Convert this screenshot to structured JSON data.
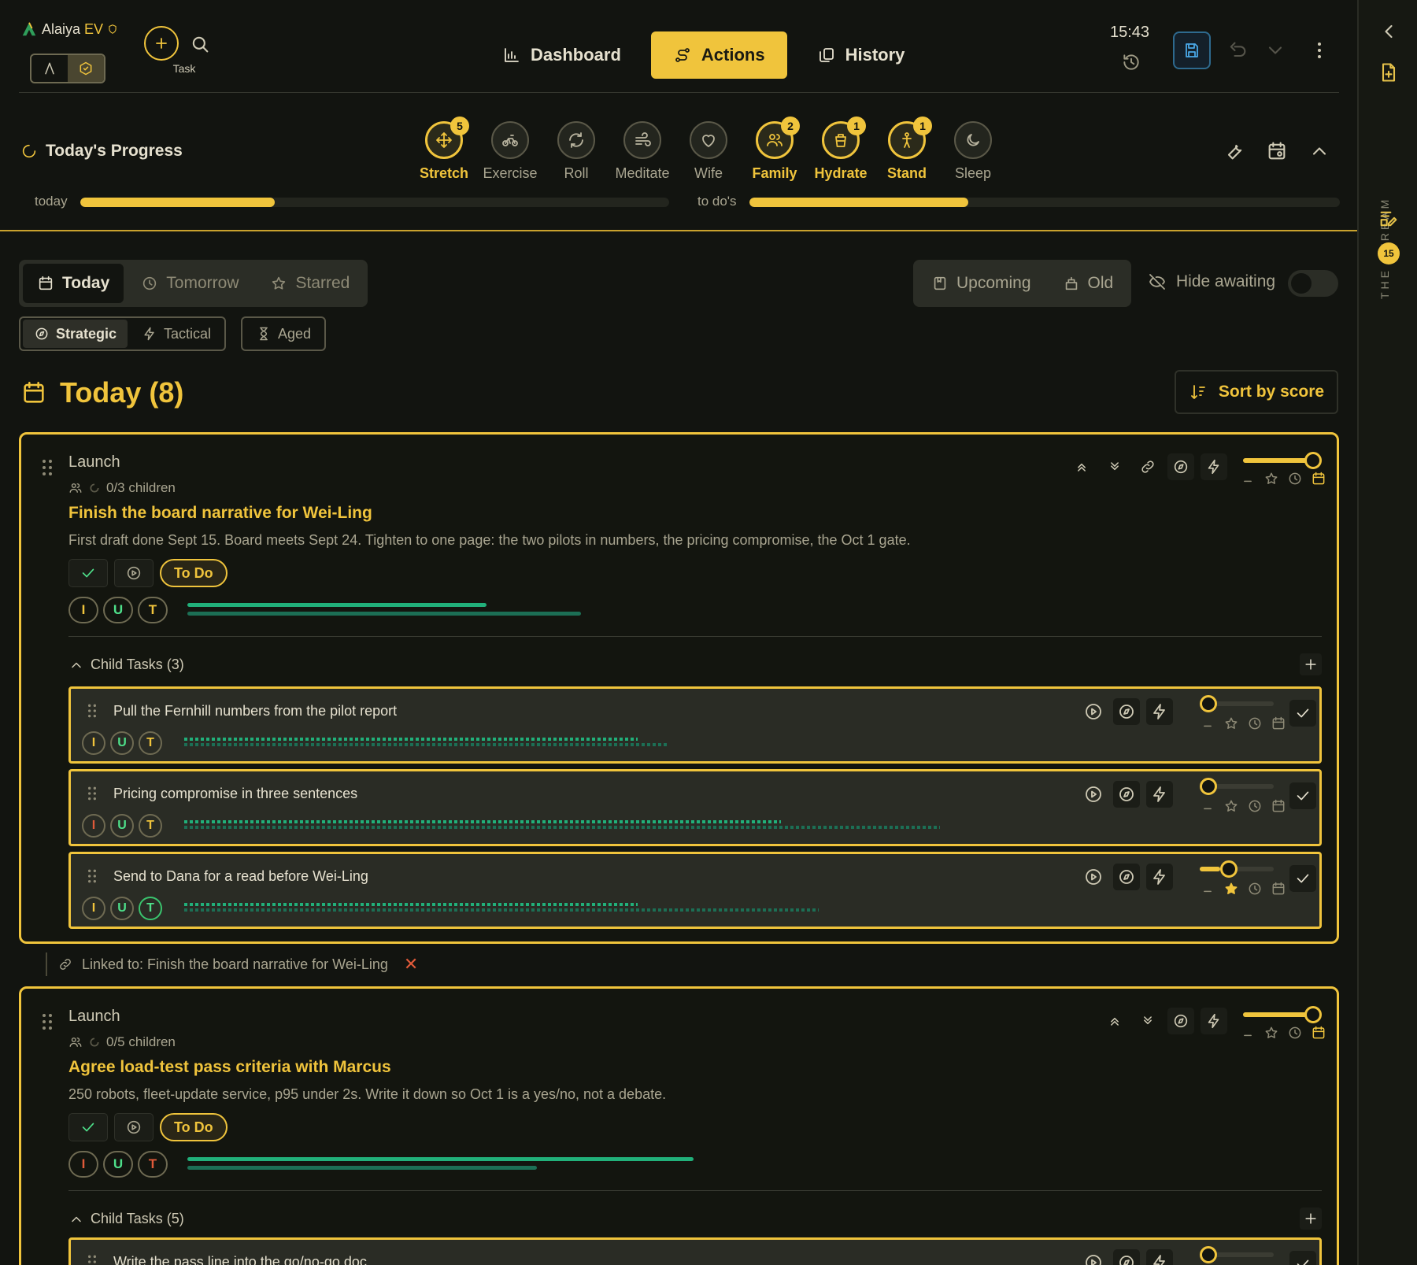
{
  "brand": {
    "name": "Alaiya",
    "suffix": "EV"
  },
  "header": {
    "task_label": "Task",
    "nav": [
      {
        "label": "Dashboard",
        "icon": "bar-chart-icon",
        "active": false
      },
      {
        "label": "Actions",
        "icon": "route-icon",
        "active": true
      },
      {
        "label": "History",
        "icon": "copy-icon",
        "active": false
      }
    ],
    "time": "15:43"
  },
  "progress": {
    "title": "Today's Progress",
    "habits": [
      {
        "label": "Stretch",
        "icon": "move-icon",
        "done": true,
        "badge": "5"
      },
      {
        "label": "Exercise",
        "icon": "bike-icon",
        "done": false,
        "badge": ""
      },
      {
        "label": "Roll",
        "icon": "rotate-icon",
        "done": false,
        "badge": ""
      },
      {
        "label": "Meditate",
        "icon": "wind-icon",
        "done": false,
        "badge": ""
      },
      {
        "label": "Wife",
        "icon": "heart-icon",
        "done": false,
        "badge": ""
      },
      {
        "label": "Family",
        "icon": "users-icon",
        "done": true,
        "badge": "2"
      },
      {
        "label": "Hydrate",
        "icon": "cup-icon",
        "done": true,
        "badge": "1"
      },
      {
        "label": "Stand",
        "icon": "person-icon",
        "done": true,
        "badge": "1"
      },
      {
        "label": "Sleep",
        "icon": "moon-icon",
        "done": false,
        "badge": ""
      }
    ],
    "today_label": "today",
    "today_fraction": 0.33,
    "todos_label": "to do's",
    "todos_fraction": 0.37
  },
  "filters": {
    "day_tabs": [
      "Today",
      "Tomorrow",
      "Starred"
    ],
    "range_tabs": [
      "Upcoming",
      "Old"
    ],
    "hide_awaiting": "Hide awaiting",
    "type_chips": [
      "Strategic",
      "Tactical"
    ],
    "aged_chip": "Aged"
  },
  "section": {
    "title": "Today (8)",
    "sort_label": "Sort by score"
  },
  "rail": {
    "label": "THE STREAM",
    "badge": "15"
  },
  "tasks": [
    {
      "project": "Launch",
      "children": "0/3 children",
      "title": "Finish the board narrative for Wei-Ling",
      "description": "First draft done Sept 15. Board meets Sept 24. Tighten to one page: the two pilots in numbers, the pricing compromise, the Oct 1 gate.",
      "status": "To Do",
      "iut": [
        "I",
        "U",
        "T"
      ],
      "progress": [
        0.76,
        1.0
      ],
      "child_header": "Child Tasks (3)",
      "child_tasks": [
        {
          "title": "Pull the Fernhill numbers from the pilot report",
          "progress": [
            0.6,
            0.64
          ]
        },
        {
          "title": "Pricing compromise in three sentences",
          "progress": [
            0.79,
            1.0
          ]
        },
        {
          "title": "Send to Dana for a read before Wei-Ling",
          "progress": [
            0.6,
            0.84
          ]
        }
      ]
    },
    {
      "project": "Launch",
      "children": "0/5 children",
      "title": "Agree load-test pass criteria with Marcus",
      "description": "250 robots, fleet-update service, p95 under 2s. Write it down so Oct 1 is a yes/no, not a debate.",
      "status": "To Do",
      "iut": [
        "I",
        "U",
        "T"
      ],
      "progress": [
        1.0,
        0.69
      ],
      "child_header": "Child Tasks (5)",
      "child_tasks": [
        {
          "title": "Write the pass line into the go/no-go doc"
        }
      ]
    }
  ],
  "linked": {
    "text": "Linked to: Finish the board narrative for Wei-Ling",
    "remove": "✕"
  },
  "colors": {
    "accent": "#f0c43c",
    "progress": "#21b07a",
    "danger": "#e05a3a",
    "background": "#121410"
  }
}
